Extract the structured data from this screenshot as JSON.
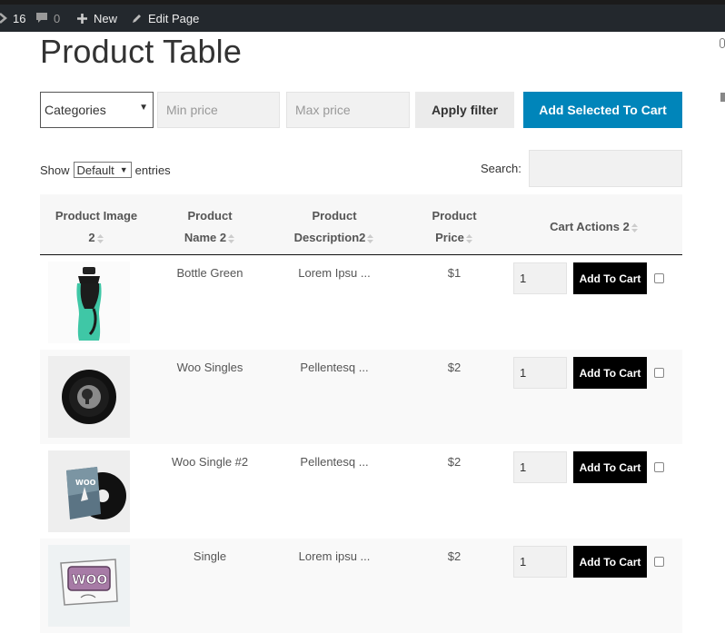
{
  "adminbar": {
    "updates_count": "16",
    "comments_count": "0",
    "new_label": "New",
    "edit_label": "Edit Page"
  },
  "page": {
    "title": "Product Table"
  },
  "filters": {
    "categories_label": "Categories",
    "min_price_placeholder": "Min price",
    "max_price_placeholder": "Max price",
    "apply_label": "Apply filter",
    "add_selected_label": "Add Selected To Cart"
  },
  "table_controls": {
    "show_label": "Show",
    "entries_value": "Default",
    "entries_label": "entries",
    "search_label": "Search:"
  },
  "columns": {
    "image_line1": "Product Image",
    "image_line2": "2",
    "name_line1": "Product",
    "name_line2": "Name 2",
    "desc_line1": "Product",
    "desc_line2": "Description2",
    "price_line1": "Product",
    "price_line2": "Price",
    "actions": "Cart Actions 2"
  },
  "rows": [
    {
      "name": "Bottle Green",
      "description": "Lorem Ipsu ...",
      "price": "$1",
      "qty": "1",
      "button": "Add To Cart",
      "image_icon": "water-bottle-image"
    },
    {
      "name": "Woo Singles",
      "description": "Pellentesq ...",
      "price": "$2",
      "qty": "1",
      "button": "Add To Cart",
      "image_icon": "vinyl-record-image"
    },
    {
      "name": "Woo Single #2",
      "description": "Pellentesq ...",
      "price": "$2",
      "qty": "1",
      "button": "Add To Cart",
      "image_icon": "album-sleeve-image",
      "sleeve_text": "WOO"
    },
    {
      "name": "Single",
      "description": "Lorem ipsu ...",
      "price": "$2",
      "qty": "1",
      "button": "Add To Cart",
      "image_icon": "woo-sticker-image",
      "sticker_text": "WOO"
    }
  ],
  "colors": {
    "accent": "#0085ba",
    "adminbar": "#23282d",
    "button": "#000000"
  }
}
